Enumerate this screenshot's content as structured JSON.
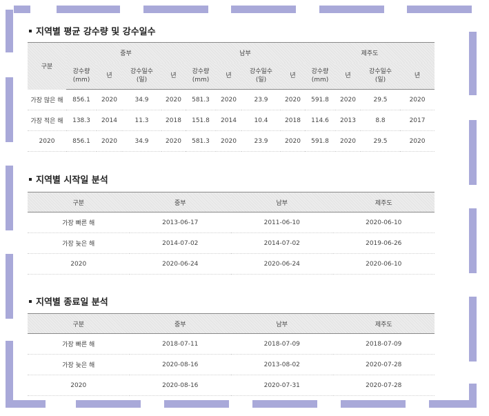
{
  "section1": {
    "title": "지역별 평균 강수량 및 강수일수",
    "header": {
      "category": "구분",
      "regions": [
        "중부",
        "남부",
        "제주도"
      ],
      "sub": [
        [
          "강수량",
          "(mm)"
        ],
        [
          "년"
        ],
        [
          "강수일수",
          "(일)"
        ],
        [
          "년"
        ],
        [
          "강수량",
          "(mm)"
        ],
        [
          "년"
        ],
        [
          "강수일수",
          "(일)"
        ],
        [
          "년"
        ],
        [
          "강수량",
          "(mm)"
        ],
        [
          "년"
        ],
        [
          "강수일수",
          "(일)"
        ],
        [
          "년"
        ]
      ]
    },
    "rows": [
      [
        "가장 많은 해",
        "856.1",
        "2020",
        "34.9",
        "2020",
        "581.3",
        "2020",
        "23.9",
        "2020",
        "591.8",
        "2020",
        "29.5",
        "2020"
      ],
      [
        "가장 적은 해",
        "138.3",
        "2014",
        "11.3",
        "2018",
        "151.8",
        "2014",
        "10.4",
        "2018",
        "114.6",
        "2013",
        "8.8",
        "2017"
      ],
      [
        "2020",
        "856.1",
        "2020",
        "34.9",
        "2020",
        "581.3",
        "2020",
        "23.9",
        "2020",
        "591.8",
        "2020",
        "29.5",
        "2020"
      ]
    ]
  },
  "section2": {
    "title": "지역별 시작일 분석",
    "header": [
      "구분",
      "중부",
      "남부",
      "제주도"
    ],
    "rows": [
      [
        "가장 빠른 해",
        "2013-06-17",
        "2011-06-10",
        "2020-06-10"
      ],
      [
        "가장 늦은 해",
        "2014-07-02",
        "2014-07-02",
        "2019-06-26"
      ],
      [
        "2020",
        "2020-06-24",
        "2020-06-24",
        "2020-06-10"
      ]
    ]
  },
  "section3": {
    "title": "지역별 종료일 분석",
    "header": [
      "구분",
      "중부",
      "남부",
      "제주도"
    ],
    "rows": [
      [
        "가장 빠른 해",
        "2018-07-11",
        "2018-07-09",
        "2018-07-09"
      ],
      [
        "가장 늦은 해",
        "2020-08-16",
        "2013-08-02",
        "2020-07-28"
      ],
      [
        "2020",
        "2020-08-16",
        "2020-07-31",
        "2020-07-28"
      ]
    ]
  }
}
